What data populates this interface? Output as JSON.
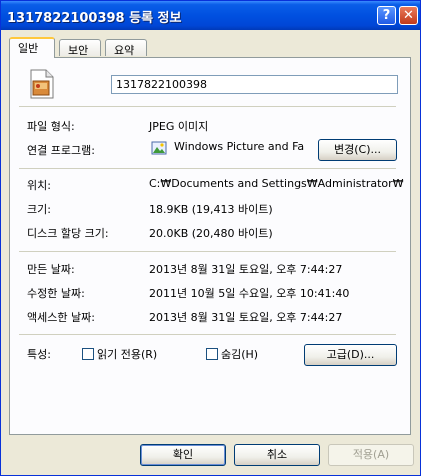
{
  "window": {
    "title": "1317822100398 등록 정보",
    "help_label": "?",
    "close_label": "✕"
  },
  "tabs": [
    {
      "label": "일반",
      "active": true
    },
    {
      "label": "보안",
      "active": false
    },
    {
      "label": "요약",
      "active": false
    }
  ],
  "general": {
    "file_icon": "jpeg-file-icon",
    "file_name": "1317822100398",
    "type_label": "파일 형식:",
    "type_value": "JPEG 이미지",
    "opens_with_label": "연결 프로그램:",
    "opens_with_value": "Windows Picture and Fa",
    "opens_with_icon": "windows-picture-viewer-icon",
    "change_button": "변경(C)...",
    "location_label": "위치:",
    "location_value": "C:₩Documents and Settings₩Administrator₩",
    "size_label": "크기:",
    "size_value": "18.9KB (19,413 바이트)",
    "size_on_disk_label": "디스크 할당 크기:",
    "size_on_disk_value": "20.0KB (20,480 바이트)",
    "created_label": "만든 날짜:",
    "created_value": "2013년 8월 31일 토요일, 오후 7:44:27",
    "modified_label": "수정한 날짜:",
    "modified_value": "2011년 10월 5일 수요일, 오후 10:41:40",
    "accessed_label": "액세스한 날짜:",
    "accessed_value": "2013년 8월 31일 토요일, 오후 7:44:27",
    "attributes_label": "특성:",
    "readonly_label": "읽기 전용(R)",
    "readonly_checked": false,
    "hidden_label": "숨김(H)",
    "hidden_checked": false,
    "advanced_button": "고급(D)..."
  },
  "footer": {
    "ok": "확인",
    "cancel": "취소",
    "apply": "적용(A)"
  }
}
